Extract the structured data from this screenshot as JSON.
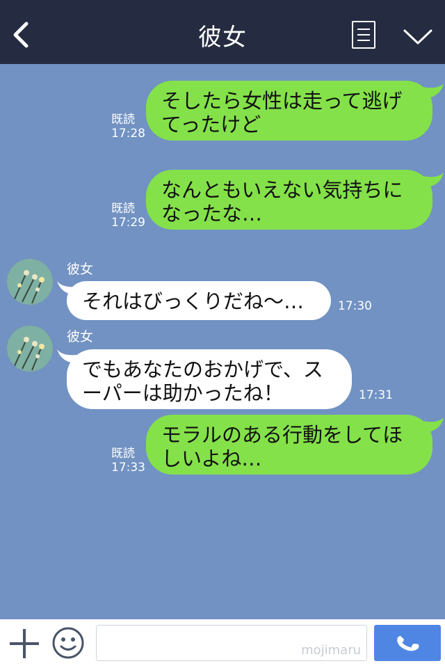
{
  "header": {
    "title": "彼女"
  },
  "messages": [
    {
      "type": "out",
      "text": "そしたら女性は走って逃げてったけど",
      "line1": "そしたら女性は走って逃げ",
      "line2": "てったけど",
      "read": "既読",
      "time": "17:28"
    },
    {
      "type": "out",
      "text": "なんともいえない気持ちになったな…",
      "line1": "なんともいえない気持ちに",
      "line2": "なったな…",
      "read": "既読",
      "time": "17:29"
    },
    {
      "type": "in",
      "sender": "彼女",
      "line1": "それはびっくりだね〜…",
      "line2": "",
      "time": "17:30"
    },
    {
      "type": "in",
      "sender": "彼女",
      "line1": "でもあなたのおかげで、ス",
      "line2": "ーパーは助かったね！",
      "time": "17:31"
    },
    {
      "type": "out",
      "line1": "モラルのある行動をしてほ",
      "line2": "しいよね…",
      "read": "既読",
      "time": "17:33"
    }
  ],
  "footer": {
    "watermark": "mojimaru"
  },
  "colors": {
    "header_bg": "#252c41",
    "chat_bg": "#7192c2",
    "outgoing": "#84e14a",
    "incoming": "#ffffff",
    "call_button": "#4f86e4"
  },
  "icons": {
    "back": "chevron-left-icon",
    "memo": "notes-icon",
    "menu": "chevron-down-icon",
    "plus": "plus-icon",
    "emoji": "smile-icon",
    "call": "phone-icon"
  }
}
